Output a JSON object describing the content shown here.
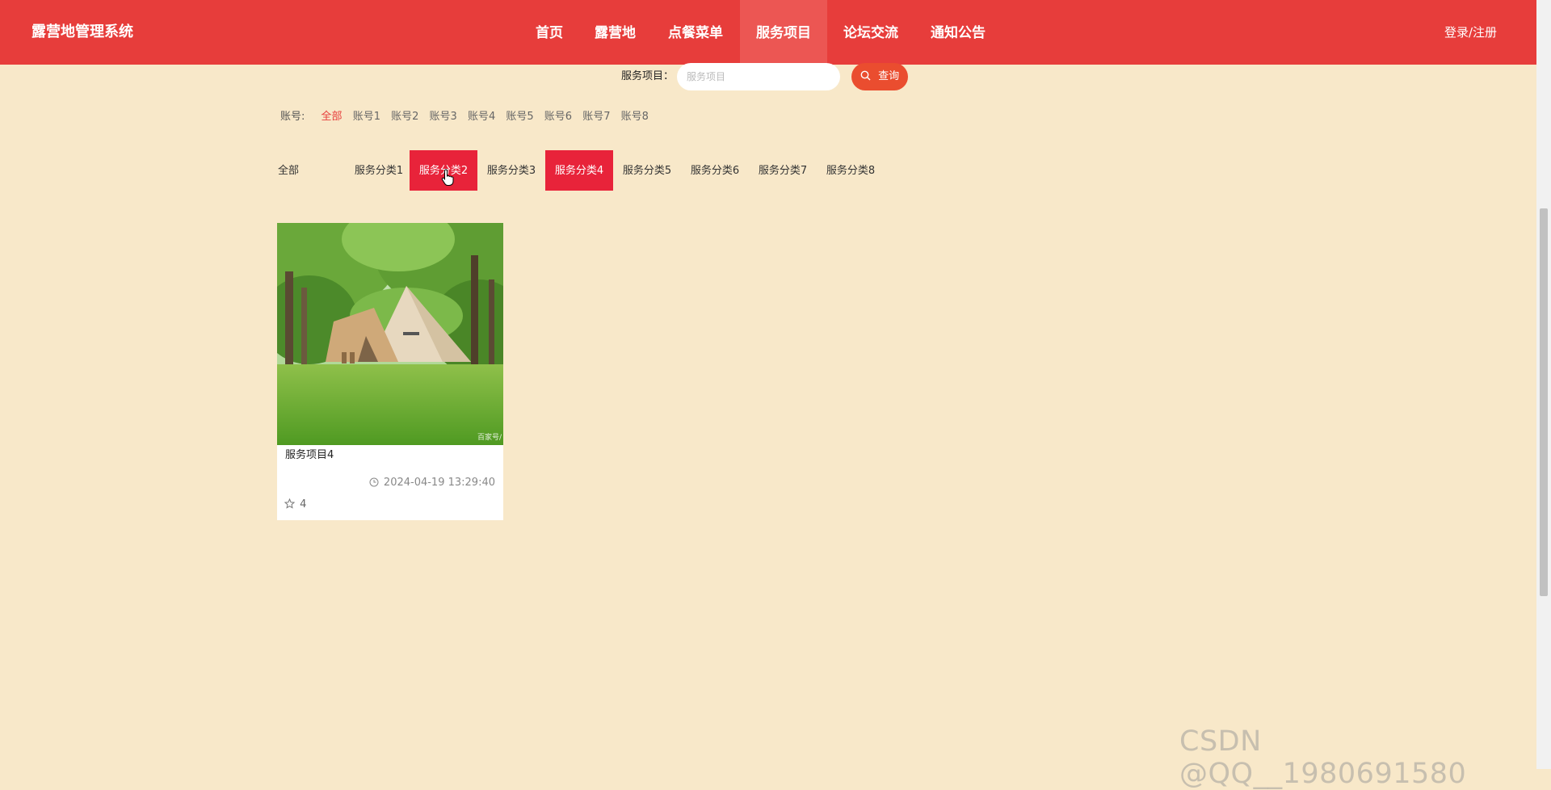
{
  "header": {
    "brand": "露营地管理系统",
    "nav": [
      {
        "label": "首页",
        "active": false
      },
      {
        "label": "露营地",
        "active": false
      },
      {
        "label": "点餐菜单",
        "active": false
      },
      {
        "label": "服务项目",
        "active": true
      },
      {
        "label": "论坛交流",
        "active": false
      },
      {
        "label": "通知公告",
        "active": false
      }
    ],
    "login_label": "登录/注册"
  },
  "search": {
    "label": "服务项目：",
    "placeholder": "服务项目",
    "value": "",
    "button_label": "查询",
    "button_icon": "search-icon"
  },
  "accounts": {
    "label": "账号:",
    "selected": "全部",
    "options": [
      "全部",
      "账号1",
      "账号2",
      "账号3",
      "账号4",
      "账号5",
      "账号6",
      "账号7",
      "账号8"
    ]
  },
  "categories": {
    "options": [
      "全部",
      "服务分类1",
      "服务分类2",
      "服务分类3",
      "服务分类4",
      "服务分类5",
      "服务分类6",
      "服务分类7",
      "服务分类8"
    ],
    "highlighted": [
      "服务分类2",
      "服务分类4"
    ]
  },
  "items": [
    {
      "title": "服务项目4",
      "time": "2024-04-19 13:29:40",
      "time_icon": "clock-icon",
      "likes": "4",
      "likes_icon": "star-icon",
      "image_watermark": "百家号/"
    }
  ],
  "watermark": "CSDN @QQ__1980691580",
  "colors": {
    "header_bg": "#e73d3b",
    "nav_active_bg": "#ec5653",
    "page_bg": "#f8e8c9",
    "category_highlight": "#e8233a",
    "search_button": "#ea4d2f"
  }
}
